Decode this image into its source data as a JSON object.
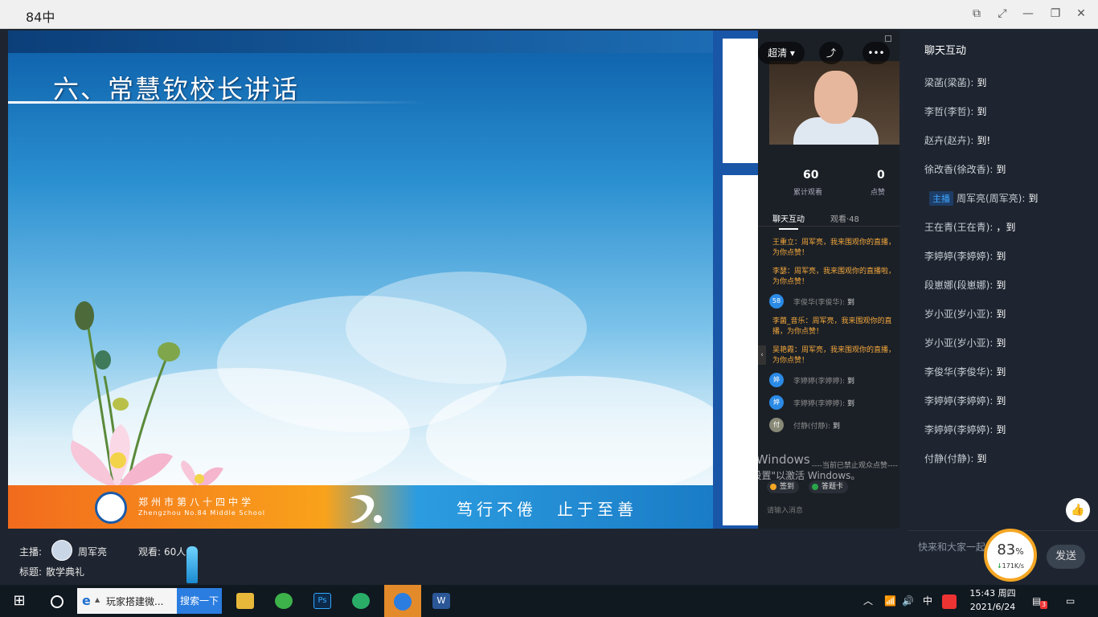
{
  "window": {
    "title": "84中",
    "controls": [
      "pin-icon",
      "expand-icon",
      "minimize-icon",
      "restore-icon",
      "close-icon"
    ]
  },
  "slide": {
    "heading": "六、常慧钦校长讲话",
    "school_cn": "郑州市第八十四中学",
    "school_en": "Zhengzhou No.84 Middle School",
    "motto": "笃行不倦　止于至善"
  },
  "phone": {
    "quality": "超清",
    "stats": {
      "views": "60",
      "views_label": "累计观看",
      "likes": "0",
      "likes_label": "点赞"
    },
    "tabs": [
      "聊天互动",
      "观看·48"
    ],
    "messages": [
      {
        "type": "like",
        "text": "王重立：周军亮，我来围观你的直播，为你点赞！"
      },
      {
        "type": "like",
        "text": "李瑟：周军亮，我来围观你的直播啦，为你点赞！"
      },
      {
        "type": "join",
        "avatar": "58",
        "name": "李俊华(李俊华):",
        "msg": "到"
      },
      {
        "type": "like",
        "text": "李菌_音乐：周军亮，我来围观你的直播，为你点赞！"
      },
      {
        "type": "like",
        "text": "吴艳霞：周军亮，我来围观你的直播，为你点赞！"
      },
      {
        "type": "join",
        "avatar": "婷",
        "name": "李婷婷(李婷婷):",
        "msg": "到"
      },
      {
        "type": "join",
        "avatar": "婷",
        "name": "李婷婷(李婷婷):",
        "msg": "到"
      },
      {
        "type": "join",
        "avatar": "付",
        "name": "付静(付静):",
        "msg": "到"
      }
    ],
    "notice": "----当前已禁止观众点赞----",
    "chips": [
      "签到",
      "答题卡"
    ],
    "input_placeholder": "请输入消息"
  },
  "watermark": {
    "line1": "激活 Windows",
    "line2": "转到\"设置\"以激活 Windows。"
  },
  "chat": {
    "header": "聊天互动",
    "messages": [
      {
        "user": "梁菡(梁菡):",
        "msg": "到"
      },
      {
        "user": "李哲(李哲):",
        "msg": "到"
      },
      {
        "user": "赵卉(赵卉):",
        "msg": "到!"
      },
      {
        "user": "徐改香(徐改香):",
        "msg": "到"
      },
      {
        "badge": "主播",
        "user": "周军亮(周军亮):",
        "msg": "到"
      },
      {
        "user": "王在青(王在青):",
        "msg": "，到"
      },
      {
        "user": "李婷婷(李婷婷):",
        "msg": "到"
      },
      {
        "user": "段崽娜(段崽娜):",
        "msg": "到"
      },
      {
        "user": "岁小亚(岁小亚):",
        "msg": "到"
      },
      {
        "user": "岁小亚(岁小亚):",
        "msg": "到"
      },
      {
        "user": "李俊华(李俊华):",
        "msg": "到"
      },
      {
        "user": "李婷婷(李婷婷):",
        "msg": "到"
      },
      {
        "user": "李婷婷(李婷婷):",
        "msg": "到"
      },
      {
        "user": "付静(付静):",
        "msg": "到"
      }
    ],
    "input_placeholder": "快来和大家一起",
    "send": "发送"
  },
  "speed": {
    "percent": "83",
    "unit": "%",
    "rate": "171K/s"
  },
  "info": {
    "host_label": "主播:",
    "host_name": "周军亮",
    "viewers_label": "观看:",
    "viewers": "60人",
    "title_label": "标题:",
    "title": "散学典礼"
  },
  "taskbar": {
    "ie_label": "玩家搭建微...",
    "search_button": "搜索一下",
    "ime": "中",
    "time": "15:43 周四",
    "date": "2021/6/24",
    "notification_count": "3"
  }
}
